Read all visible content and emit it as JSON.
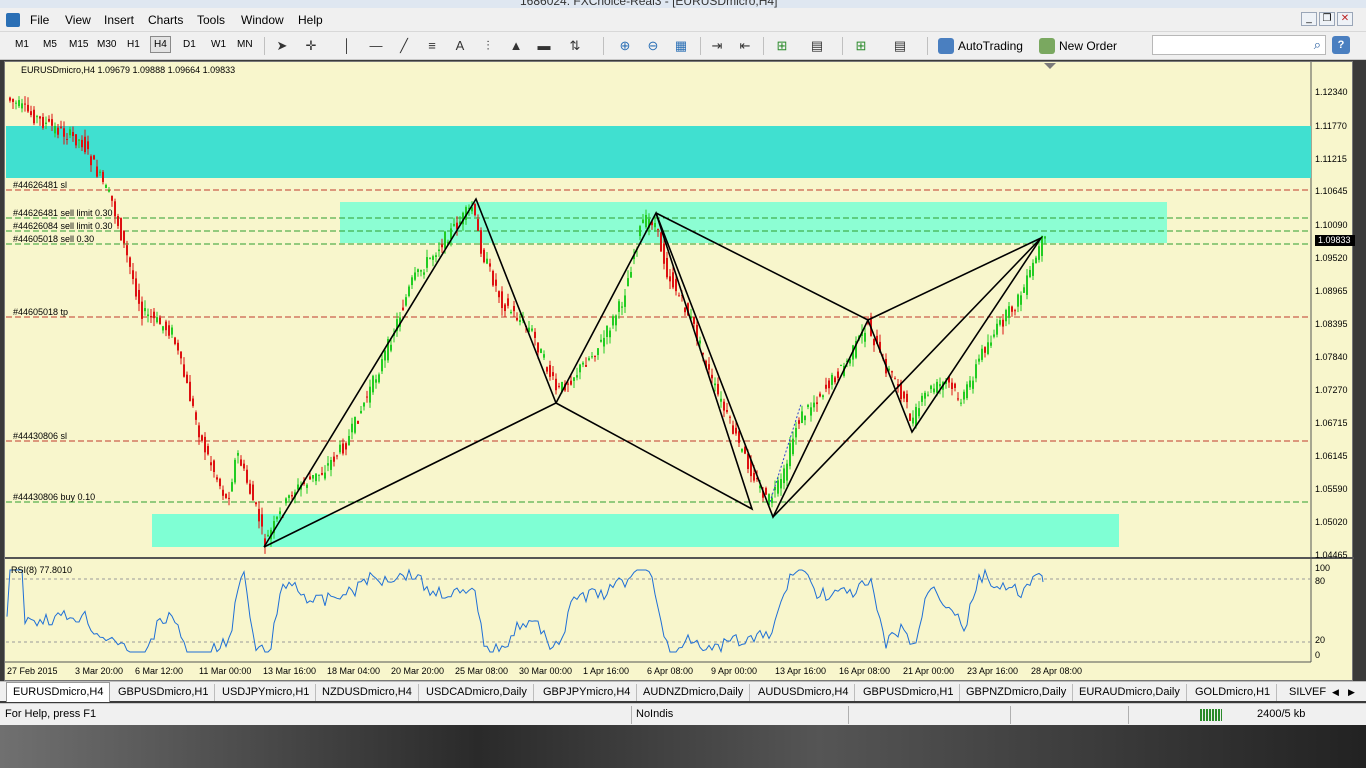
{
  "window": {
    "title": "1686024: FXChoice-Real3 - [EURUSDmicro,H4]"
  },
  "menu": [
    "File",
    "View",
    "Insert",
    "Charts",
    "Tools",
    "Window",
    "Help"
  ],
  "toolbar": {
    "timeframes": [
      "M1",
      "M5",
      "M15",
      "M30",
      "H1",
      "H4",
      "D1",
      "W1",
      "MN"
    ],
    "active_timeframe": "H4",
    "autotrading_label": "AutoTrading",
    "new_order_label": "New Order",
    "search_value": ""
  },
  "chart": {
    "header": "EURUSDmicro,H4  1.09679 1.09888 1.09664 1.09833",
    "current_price": "1.09833",
    "price_axis": [
      "1.12340",
      "1.11770",
      "1.11215",
      "1.10645",
      "1.10090",
      "1.09520",
      "1.08965",
      "1.08395",
      "1.07840",
      "1.07270",
      "1.06715",
      "1.06145",
      "1.05590",
      "1.05020",
      "1.04465"
    ],
    "levels": [
      {
        "label": "#44626481 sl",
        "color": "#c0392b"
      },
      {
        "label": "#44626481 sell limit 0.30",
        "color": "#2e9e2e"
      },
      {
        "label": "#44626084 sell limit 0.30",
        "color": "#2e9e2e"
      },
      {
        "label": "#44605018 sell 0.30",
        "color": "#2e9e2e"
      },
      {
        "label": "#44605018 tp",
        "color": "#c0392b"
      },
      {
        "label": "#44430806 sl",
        "color": "#c0392b"
      },
      {
        "label": "#44430806 buy 0.10",
        "color": "#2e9e2e"
      }
    ],
    "rsi_header": "RSI(8) 77.8010",
    "rsi_axis": [
      "100",
      "80",
      "20",
      "0"
    ],
    "dates": [
      "27 Feb 2015",
      "3 Mar 20:00",
      "6 Mar 12:00",
      "11 Mar 00:00",
      "13 Mar 16:00",
      "18 Mar 04:00",
      "20 Mar 20:00",
      "25 Mar 08:00",
      "30 Mar 00:00",
      "1 Apr 16:00",
      "6 Apr 08:00",
      "9 Apr 00:00",
      "13 Apr 16:00",
      "16 Apr 08:00",
      "21 Apr 00:00",
      "23 Apr 16:00",
      "28 Apr 08:00"
    ],
    "colors": {
      "background": "#f8f6cc",
      "zone": "#40e0d0",
      "zone_light": "#7fffd4",
      "bull": "#22cc22",
      "bear": "#dd1111",
      "rsi": "#1e6fd6"
    }
  },
  "tabs": [
    "EURUSDmicro,H4",
    "GBPUSDmicro,H1",
    "USDJPYmicro,H1",
    "NZDUSDmicro,H4",
    "USDCADmicro,Daily",
    "GBPJPYmicro,H4",
    "AUDNZDmicro,Daily",
    "AUDUSDmicro,H4",
    "GBPUSDmicro,H1",
    "GBPNZDmicro,Daily",
    "EURAUDmicro,Daily",
    "GOLDmicro,H1",
    "SILVEF"
  ],
  "status": {
    "help": "For Help, press F1",
    "profile": "NoIndis",
    "traffic": "2400/5 kb"
  }
}
